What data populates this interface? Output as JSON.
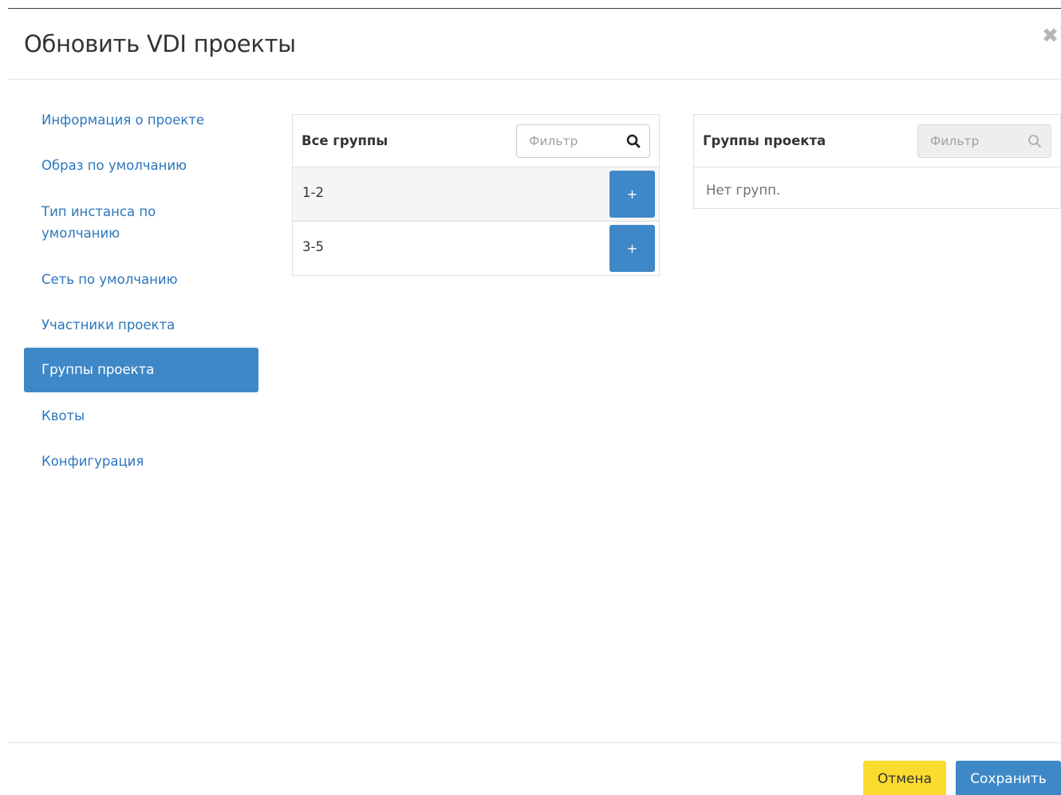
{
  "modal": {
    "title": "Обновить VDI проекты",
    "close_icon": "close-icon"
  },
  "nav": {
    "items": [
      {
        "label": "Информация о проекте",
        "active": false
      },
      {
        "label": "Образ по умолчанию",
        "active": false
      },
      {
        "label": "Тип инстанса по умолчанию",
        "active": false
      },
      {
        "label": "Сеть по умолчанию",
        "active": false
      },
      {
        "label": "Участники проекта",
        "active": false
      },
      {
        "label": "Группы проекта",
        "active": true
      },
      {
        "label": "Квоты",
        "active": false
      },
      {
        "label": "Конфигурация",
        "active": false
      }
    ]
  },
  "all_groups": {
    "title": "Все группы",
    "filter_placeholder": "Фильтр",
    "rows": [
      {
        "name": "1-2",
        "action": "+"
      },
      {
        "name": "3-5",
        "action": "+"
      }
    ]
  },
  "project_groups": {
    "title": "Группы проекта",
    "filter_placeholder": "Фильтр",
    "empty_text": "Нет групп."
  },
  "footer": {
    "cancel_label": "Отмена",
    "save_label": "Сохранить"
  },
  "colors": {
    "primary": "#3f88c8",
    "link": "#2b76bd",
    "cancel": "#fcdb2f"
  }
}
